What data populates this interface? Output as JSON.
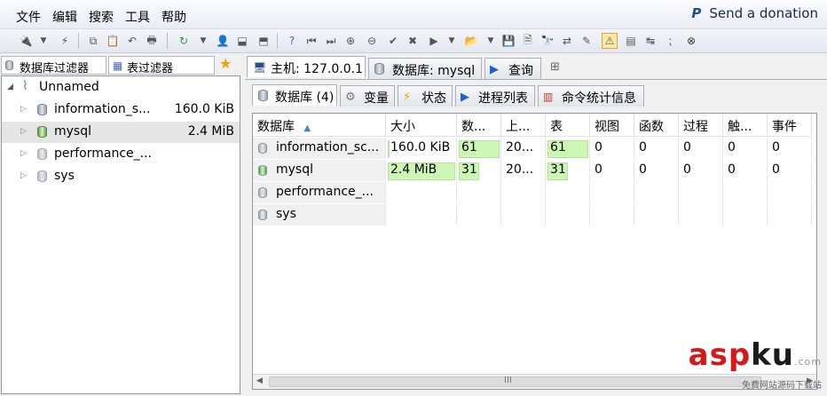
{
  "menu": {
    "items": [
      "文件",
      "编辑",
      "搜索",
      "工具",
      "帮助"
    ],
    "donate": "Send a donation"
  },
  "left": {
    "tab_db_filter": "数据库过滤器",
    "tab_table_filter": "表过滤器",
    "root": "Unnamed",
    "databases": [
      {
        "name": "information_s...",
        "size": "160.0 KiB"
      },
      {
        "name": "mysql",
        "size": "2.4 MiB"
      },
      {
        "name": "performance_...",
        "size": ""
      },
      {
        "name": "sys",
        "size": ""
      }
    ]
  },
  "right": {
    "top_tabs": [
      "主机: 127.0.0.1",
      "数据库: mysql",
      "查询"
    ],
    "sub_tabs": [
      "数据库 (4)",
      "变量",
      "状态",
      "进程列表",
      "命令统计信息"
    ],
    "columns": [
      "数据库",
      "大小",
      "数...",
      "上...",
      "表",
      "视图",
      "函数",
      "过程",
      "触...",
      "事件"
    ],
    "sort_indicator": "▲",
    "rows": [
      {
        "db": "information_sc...",
        "size": "160.0 KiB",
        "items": "61",
        "updated": "20...",
        "tables": "61",
        "views": "0",
        "funcs": "0",
        "procs": "0",
        "triggers": "0",
        "events": "0",
        "size_bar": 0.01,
        "items_bar": 1.0,
        "tables_bar": 1.0
      },
      {
        "db": "mysql",
        "size": "2.4 MiB",
        "items": "31",
        "updated": "20...",
        "tables": "31",
        "views": "0",
        "funcs": "0",
        "procs": "0",
        "triggers": "0",
        "events": "0",
        "size_bar": 1.0,
        "items_bar": 0.5,
        "tables_bar": 0.5
      },
      {
        "db": "performance_...",
        "size": "",
        "items": "",
        "updated": "",
        "tables": "",
        "views": "",
        "funcs": "",
        "procs": "",
        "triggers": "",
        "events": ""
      },
      {
        "db": "sys",
        "size": "",
        "items": "",
        "updated": "",
        "tables": "",
        "views": "",
        "funcs": "",
        "procs": "",
        "triggers": "",
        "events": ""
      }
    ],
    "scroll_grip": "III"
  },
  "watermark": {
    "main_a": "asp",
    "main_b": "ku",
    "tld": ".com",
    "sub": "免费网站源码下载站"
  },
  "colors": {
    "bar": "#ccf7b4",
    "accent": "#1f4e8f"
  }
}
